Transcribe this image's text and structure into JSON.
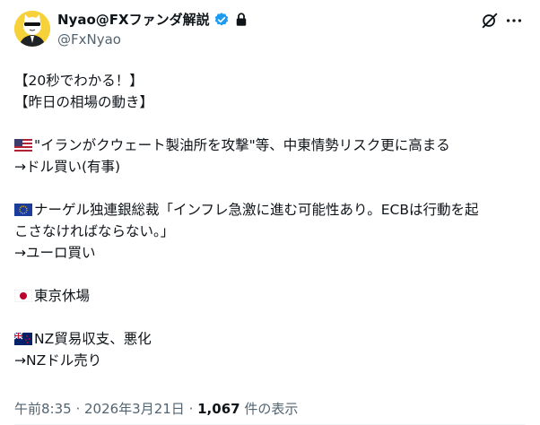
{
  "author": {
    "display_name": "Nyao@FXファンダ解説",
    "handle": "@FxNyao"
  },
  "icons": {
    "avatar": "cat-avatar",
    "verified": "verified-badge-icon",
    "protected": "lock-icon",
    "grok": "grok-icon",
    "more": "more-icon",
    "colors": {
      "verified": "#1d9bf0",
      "text": "#0f1419",
      "muted": "#536471"
    }
  },
  "lines": {
    "l1": "【20秒でわかる！】",
    "l2": "【昨日の相場の動き】",
    "l3": "\"イランがクウェート製油所を攻撃\"等、中東情勢リスク更に高まる",
    "l4": "→ドル買い(有事)",
    "l5": "ナーゲル独連銀総裁「インフレ急激に進む可能性あり。ECBは行動を起",
    "l6": "こさなければならない。」",
    "l7": "→ユーロ買い",
    "l8": "東京休場",
    "l9": "NZ貿易収支、悪化",
    "l10": "→NZドル売り"
  },
  "flags": {
    "us": "us-flag",
    "eu": "eu-flag",
    "jp": "jp-flag",
    "nz": "nz-flag"
  },
  "meta": {
    "time": "午前8:35",
    "sep1": " · ",
    "date": "2026年3月21日",
    "sep2": " · ",
    "views_count": "1,067",
    "views_label": " 件の表示"
  }
}
